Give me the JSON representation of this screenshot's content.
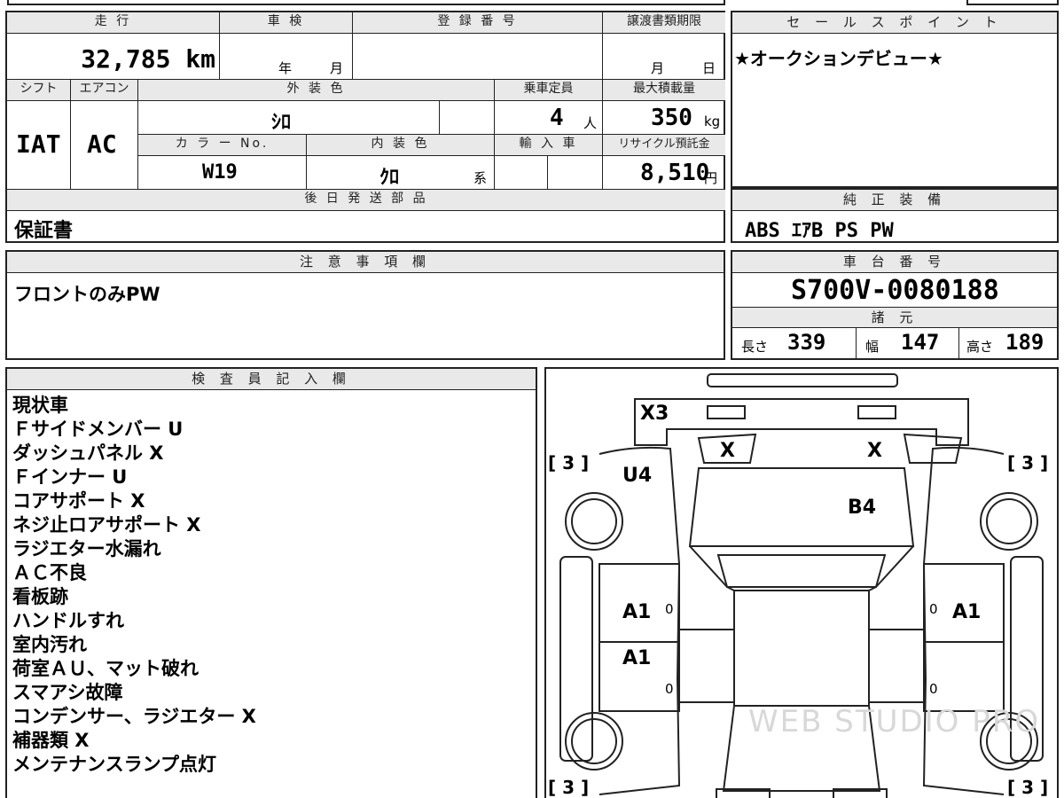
{
  "mileage": {
    "label": "走 行",
    "value": "32,785 km"
  },
  "shaken": {
    "label": "車 検",
    "year_unit": "年",
    "month_unit": "月"
  },
  "registration": {
    "label": "登 録 番 号",
    "value": ""
  },
  "transfer_deadline": {
    "label": "譲渡書類期限",
    "month_unit": "月",
    "day_unit": "日"
  },
  "shift": {
    "label": "シフト",
    "value": "IAT"
  },
  "aircon": {
    "label": "エアコン",
    "value": "AC"
  },
  "exterior_color": {
    "label": "外 装 色",
    "value": "ｼﾛ"
  },
  "color_no": {
    "label": "カ ラ ー No.",
    "value": "W19"
  },
  "interior_color": {
    "label": "内 装 色",
    "value": "ｸﾛ",
    "suffix": "系"
  },
  "capacity": {
    "label": "乗車定員",
    "value": "4",
    "unit": "人"
  },
  "max_load": {
    "label": "最大積載量",
    "value": "350",
    "unit": "kg"
  },
  "import_car": {
    "label": "輸 入 車"
  },
  "recycle": {
    "label": "リサイクル預託金",
    "value": "8,510",
    "unit": "円"
  },
  "later_parts": {
    "label": "後 日 発 送 部 品",
    "value": "保証書"
  },
  "sales_point": {
    "label": "セ ー ル ス ポ イ ン ト",
    "value": "★オークションデビュー★"
  },
  "genuine_equipment": {
    "label": "純 正 装 備",
    "value": "ABS ｴｱB PS PW"
  },
  "notes": {
    "label": "注 意 事 項 欄",
    "value": "フロントのみPW"
  },
  "chassis": {
    "label": "車 台 番 号",
    "value": "S700V-0080188"
  },
  "specs": {
    "label": "諸 元",
    "length_label": "長さ",
    "length": "339",
    "width_label": "幅",
    "width": "147",
    "height_label": "高さ",
    "height": "189"
  },
  "inspector": {
    "label": "検 査 員 記 入 欄",
    "lines": [
      "現状車",
      "Ｆサイドメンバー U",
      "ダッシュパネル X",
      "Ｆインナー U",
      "コアサポート X",
      "ネジ止ロアサポート X",
      "ラジエター水漏れ",
      "ＡＣ不良",
      "看板跡",
      "ハンドルすれ",
      "室内汚れ",
      "荷室ＡＵ、マット破れ",
      "スマアシ故障",
      "コンデンサー、ラジエター X",
      "補器類 X",
      "メンテナンスランプ点灯"
    ]
  },
  "diagram": {
    "x3": "X3",
    "x_left": "X",
    "x_right": "X",
    "u4": "U4",
    "b4": "B4",
    "a1_left_upper": "A1",
    "a1_left_lower": "A1",
    "a1_right_upper": "A1",
    "zero_1": "0",
    "zero_2": "0",
    "zero_3": "0",
    "zero_4": "0",
    "tire_tl": "[ 3 ]",
    "tire_tr": "[ 3 ]",
    "tire_bl": "[ 3 ]",
    "tire_br": "[ 3 ]",
    "watermark": "WEB STUDIO PRO"
  }
}
